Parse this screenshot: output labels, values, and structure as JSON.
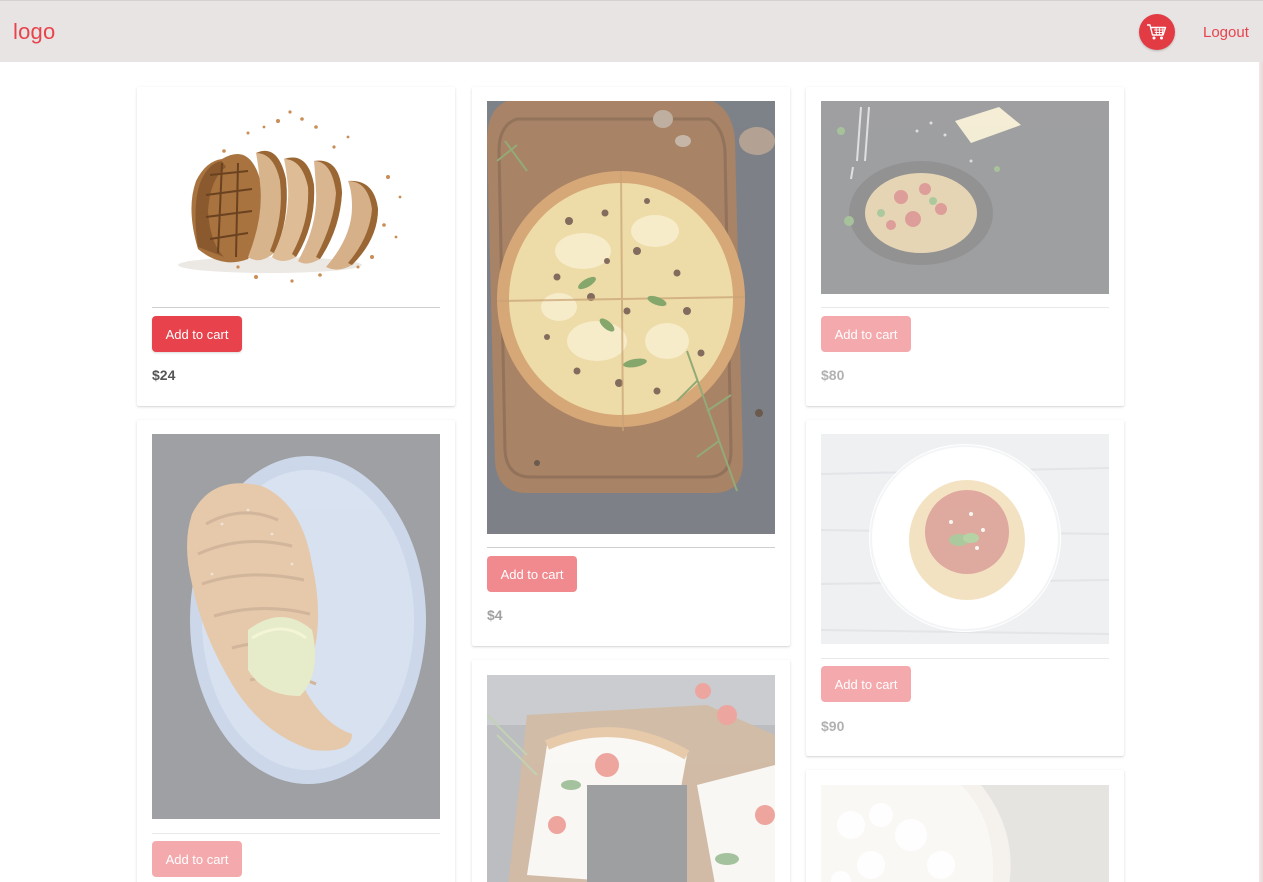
{
  "header": {
    "logo": "logo",
    "cart_icon": "shopping-cart-icon",
    "logout_label": "Logout"
  },
  "colors": {
    "accent": "#e8434c",
    "header_bg": "#e8e4e4"
  },
  "products": [
    {
      "image": "bread",
      "button_label": "Add to cart",
      "price": "$24"
    },
    {
      "image": "pizza-mushroom",
      "button_label": "Add to cart",
      "price": "$4"
    },
    {
      "image": "spaghetti-dark",
      "button_label": "Add to cart",
      "price": "$80"
    },
    {
      "image": "croissant",
      "button_label": "Add to cart"
    },
    {
      "image": "spaghetti-plate",
      "button_label": "Add to cart",
      "price": "$90"
    },
    {
      "image": "pizza-margherita"
    },
    {
      "image": "cream"
    }
  ]
}
